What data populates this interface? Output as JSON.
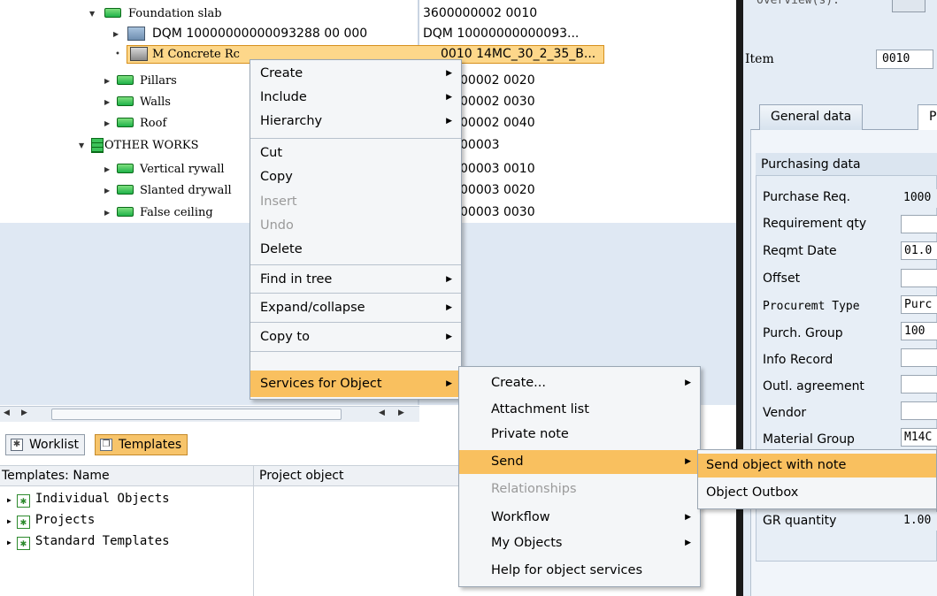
{
  "tree": {
    "rows": [
      {
        "label": "Foundation slab",
        "object": "3600000002 0010"
      },
      {
        "label": "DQM 10000000000093288 00 000",
        "object": "DQM 10000000000093..."
      },
      {
        "label": "M Concrete Rc",
        "object": "0010 14MC_30_2_35_B..."
      },
      {
        "label": "Pillars",
        "object": "00002 0020"
      },
      {
        "label": "Walls",
        "object": "00002 0030"
      },
      {
        "label": "Roof",
        "object": "00002 0040"
      },
      {
        "label": "OTHER WORKS",
        "object": "00003"
      },
      {
        "label": "Vertical rywall",
        "object": "00003 0010"
      },
      {
        "label": "Slanted drywall",
        "object": "00003 0020"
      },
      {
        "label": "False ceiling",
        "object": "00003 0030"
      }
    ]
  },
  "context_menu": {
    "items": [
      "Create",
      "Include",
      "Hierarchy",
      "Cut",
      "Copy",
      "Insert",
      "Undo",
      "Delete",
      "Find in tree",
      "Expand/collapse",
      "Copy to",
      "Services for Object"
    ]
  },
  "services_menu": {
    "items": [
      "Create...",
      "Attachment list",
      "Private note",
      "Send",
      "Relationships",
      "Workflow",
      "My Objects",
      "Help for object services"
    ]
  },
  "send_menu": {
    "items": [
      "Send object with note",
      "Object Outbox"
    ]
  },
  "worklist": {
    "tab_worklist": "Worklist",
    "tab_templates": "Templates",
    "col_name": "Templates: Name",
    "col_object": "Project object",
    "rows": [
      "Individual Objects",
      "Projects",
      "Standard Templates"
    ]
  },
  "detail": {
    "overview_label": "Overview(s):",
    "item_label": "Item",
    "item_value": "0010",
    "tab_general": "General data",
    "tab_purch": "Purch.",
    "group_title": "Purchasing data",
    "fields": [
      {
        "label": "Purchase Req.",
        "value": "1000"
      },
      {
        "label": "Requirement qty",
        "value": ""
      },
      {
        "label": "Reqmt Date",
        "value": "01.0"
      },
      {
        "label": "Offset",
        "value": ""
      },
      {
        "label": "Procuremt Type",
        "value": "Purc"
      },
      {
        "label": "Purch. Group",
        "value": "100"
      },
      {
        "label": "Info Record",
        "value": ""
      },
      {
        "label": "Outl. agreement",
        "value": ""
      },
      {
        "label": "Vendor",
        "value": ""
      },
      {
        "label": "Material Group",
        "value": "M14C"
      },
      {
        "label": "GR quantity",
        "value": "1.00"
      }
    ]
  },
  "colors": {
    "menu_highlight": "#f9c05f",
    "selection": "#fdd78a",
    "pane_blue": "#dfe8f3"
  }
}
